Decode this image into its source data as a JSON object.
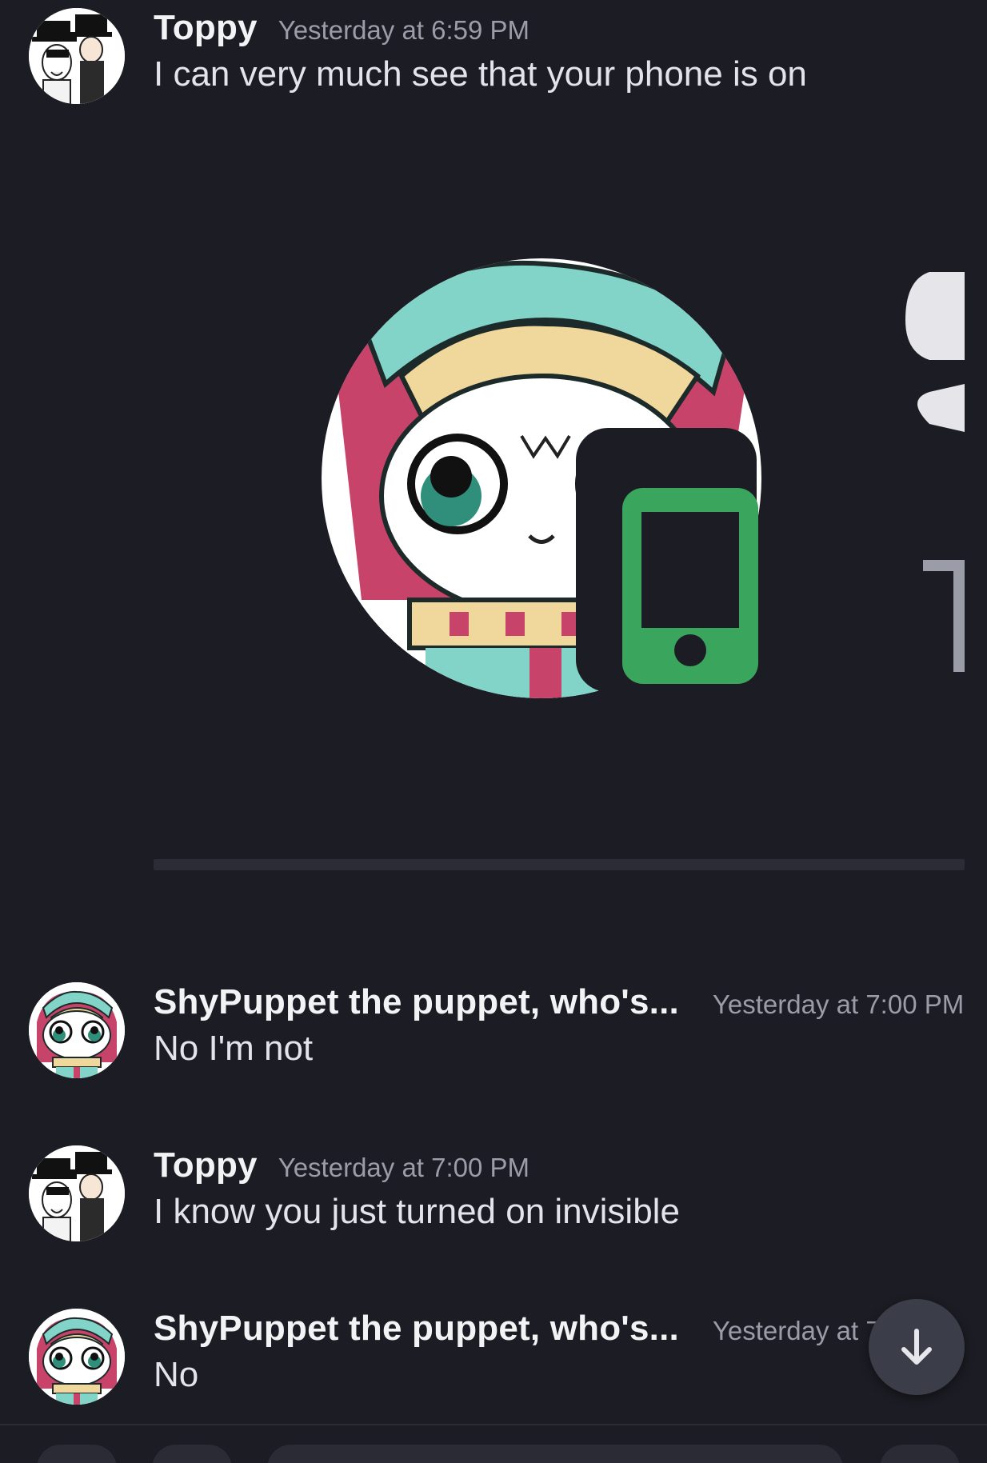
{
  "colors": {
    "background": "#1c1c24",
    "username": "#f2f3f5",
    "timestamp": "#9a9ca8",
    "message_text": "#e3e4ea",
    "mobile_status": "#3aa55c",
    "scroll_button": "#3b3d48"
  },
  "messages": [
    {
      "username": "Toppy",
      "timestamp": "Yesterday at 6:59 PM",
      "text": "I can very much see that your phone is on",
      "avatar_icon": "top-hat-duo-avatar"
    },
    {
      "username": "ShyPuppet the puppet, who's...",
      "timestamp": "Yesterday at 7:00 PM",
      "text": "No I'm not",
      "avatar_icon": "puppet-cat-avatar"
    },
    {
      "username": "Toppy",
      "timestamp": "Yesterday at 7:00 PM",
      "text": "I know you just turned on invisible",
      "avatar_icon": "top-hat-duo-avatar"
    },
    {
      "username": "ShyPuppet the puppet, who's...",
      "timestamp": "Yesterday at 7",
      "text": "No",
      "avatar_icon": "puppet-cat-avatar"
    }
  ],
  "embed": {
    "image_icon": "puppet-cat-profile-with-mobile-status",
    "status_icon": "mobile-phone-icon"
  },
  "scroll_button": {
    "icon": "arrow-down-icon"
  }
}
